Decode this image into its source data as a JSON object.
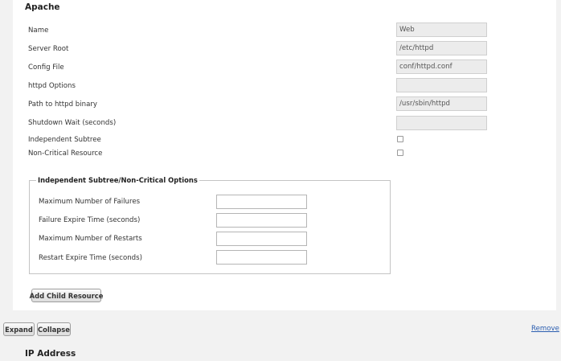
{
  "apache": {
    "title": "Apache",
    "fields": [
      {
        "label": "Name",
        "value": "Web"
      },
      {
        "label": "Server Root",
        "value": "/etc/httpd"
      },
      {
        "label": "Config File",
        "value": "conf/httpd.conf"
      },
      {
        "label": "httpd Options",
        "value": ""
      },
      {
        "label": "Path to httpd binary",
        "value": "/usr/sbin/httpd"
      },
      {
        "label": "Shutdown Wait (seconds)",
        "value": ""
      }
    ],
    "checkboxes": [
      {
        "label": "Independent Subtree",
        "checked": false
      },
      {
        "label": "Non-Critical Resource",
        "checked": false
      }
    ],
    "options_group": {
      "legend": "Independent Subtree/Non-Critical Options",
      "fields": [
        {
          "label": "Maximum Number of Failures",
          "value": ""
        },
        {
          "label": "Failure Expire Time (seconds)",
          "value": ""
        },
        {
          "label": "Maximum Number of Restarts",
          "value": ""
        },
        {
          "label": "Restart Expire Time (seconds)",
          "value": ""
        }
      ]
    },
    "add_child_label": "Add Child Resource"
  },
  "toolbar": {
    "expand_label": "Expand",
    "collapse_label": "Collapse",
    "remove_label": "Remove"
  },
  "next_section": {
    "title": "IP Address"
  }
}
